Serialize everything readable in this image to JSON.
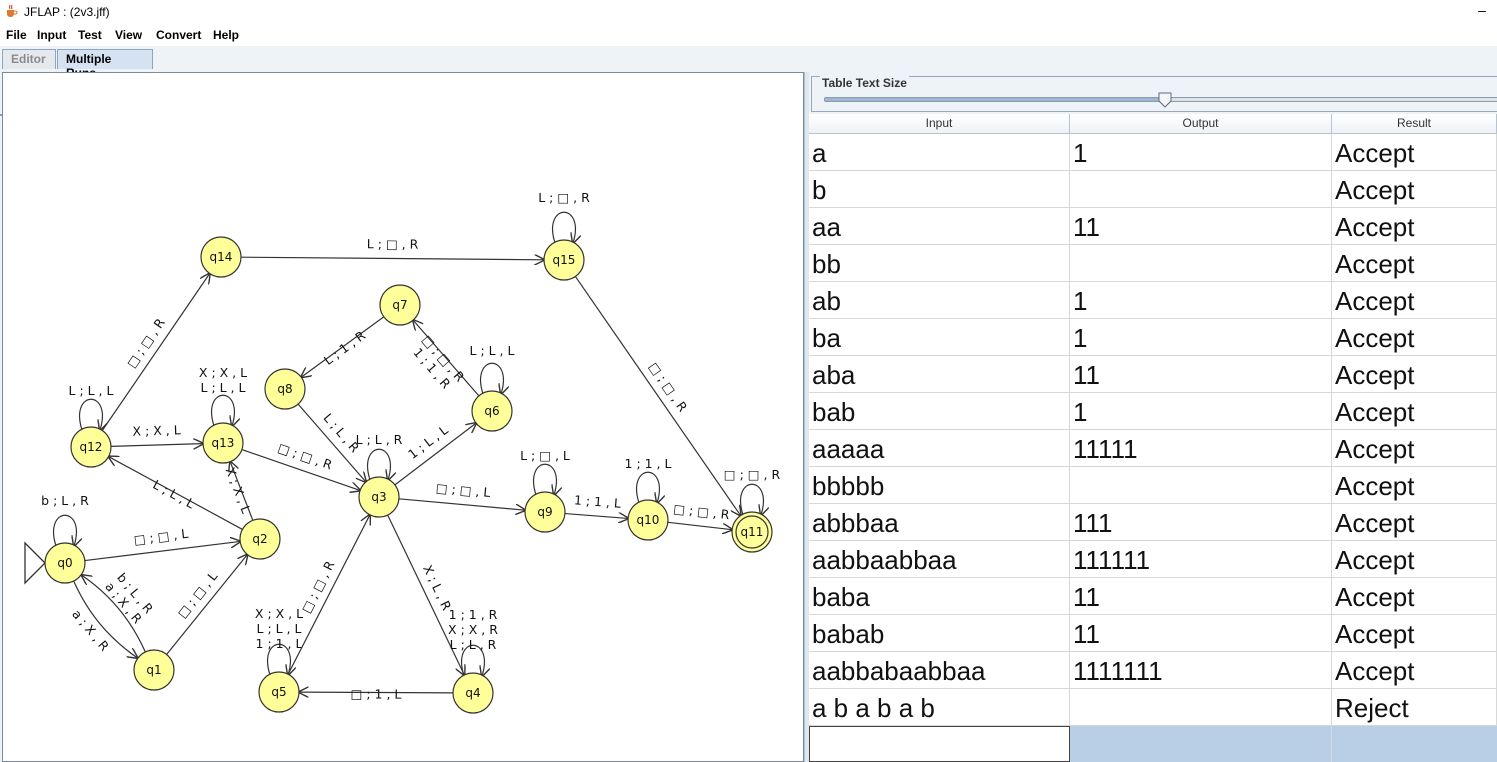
{
  "window": {
    "title": "JFLAP : (2v3.jff)",
    "minimize_glyph": "–",
    "icon": "java-cup-icon"
  },
  "menu": [
    "File",
    "Input",
    "Test",
    "View",
    "Convert",
    "Help"
  ],
  "tabs": [
    {
      "label": "Editor",
      "active": false
    },
    {
      "label": "Multiple Runs",
      "active": true
    }
  ],
  "slider": {
    "label": "Table Text Size",
    "value": 0.5
  },
  "table": {
    "columns": [
      "Input",
      "Output",
      "Result"
    ],
    "rows": [
      {
        "input": "a",
        "output": "1",
        "result": "Accept"
      },
      {
        "input": "b",
        "output": "",
        "result": "Accept"
      },
      {
        "input": "aa",
        "output": "11",
        "result": "Accept"
      },
      {
        "input": "bb",
        "output": "",
        "result": "Accept"
      },
      {
        "input": "ab",
        "output": "1",
        "result": "Accept"
      },
      {
        "input": "ba",
        "output": "1",
        "result": "Accept"
      },
      {
        "input": "aba",
        "output": "11",
        "result": "Accept"
      },
      {
        "input": "bab",
        "output": "1",
        "result": "Accept"
      },
      {
        "input": "aaaaa",
        "output": "11111",
        "result": "Accept"
      },
      {
        "input": "bbbbb",
        "output": "",
        "result": "Accept"
      },
      {
        "input": "abbbaa",
        "output": "111",
        "result": "Accept"
      },
      {
        "input": "aabbaabbaa",
        "output": "111111",
        "result": "Accept"
      },
      {
        "input": "baba",
        "output": "11",
        "result": "Accept"
      },
      {
        "input": "babab",
        "output": "11",
        "result": "Accept"
      },
      {
        "input": "aabbabaabbaa",
        "output": "1111111",
        "result": "Accept"
      },
      {
        "input": "a b a b a b",
        "output": "",
        "result": "Reject"
      }
    ],
    "edit_row": {
      "input": "",
      "output": "",
      "result": ""
    }
  },
  "automaton": {
    "colors": {
      "state_fill": "#ffff99",
      "state_stroke": "#333333",
      "edge": "#333333"
    },
    "initial_state": "q0",
    "final_states": [
      "q11"
    ],
    "states": [
      "q0",
      "q1",
      "q2",
      "q3",
      "q4",
      "q5",
      "q6",
      "q7",
      "q8",
      "q9",
      "q10",
      "q11",
      "q12",
      "q13",
      "q14",
      "q15"
    ],
    "transitions": [
      {
        "from": "q0",
        "to": "q0",
        "labels": [
          "b ; L , R"
        ]
      },
      {
        "from": "q0",
        "to": "q2",
        "labels": [
          "□ ; □ , L"
        ]
      },
      {
        "from": "q0",
        "to": "q1",
        "labels": [
          "a ; X , R"
        ]
      },
      {
        "from": "q1",
        "to": "q0",
        "labels": [
          "b ; L , R",
          "a ; X , R"
        ]
      },
      {
        "from": "q1",
        "to": "q2",
        "labels": [
          "□ ; □ , L"
        ]
      },
      {
        "from": "q2",
        "to": "q13",
        "labels": [
          "X ; X , L"
        ]
      },
      {
        "from": "q2",
        "to": "q12",
        "labels": [
          "L ; L , L"
        ]
      },
      {
        "from": "q12",
        "to": "q12",
        "labels": [
          "L ; L , L"
        ]
      },
      {
        "from": "q12",
        "to": "q13",
        "labels": [
          "X ; X , L"
        ]
      },
      {
        "from": "q12",
        "to": "q14",
        "labels": [
          "□ ; □ , R"
        ]
      },
      {
        "from": "q13",
        "to": "q13",
        "labels": [
          "X ; X , L",
          "L ; L , L"
        ]
      },
      {
        "from": "q13",
        "to": "q3",
        "labels": [
          "□ ; □ , R"
        ]
      },
      {
        "from": "q14",
        "to": "q15",
        "labels": [
          "L ; □ , R"
        ]
      },
      {
        "from": "q15",
        "to": "q15",
        "labels": [
          "L ; □ , R"
        ]
      },
      {
        "from": "q15",
        "to": "q11",
        "labels": [
          "□ ; □ , R"
        ]
      },
      {
        "from": "q7",
        "to": "q8",
        "labels": [
          "L ; 1 , R"
        ]
      },
      {
        "from": "q8",
        "to": "q3",
        "labels": [
          "L ; L , R"
        ]
      },
      {
        "from": "q3",
        "to": "q3",
        "labels": [
          "L ; L , R"
        ]
      },
      {
        "from": "q3",
        "to": "q6",
        "labels": [
          "1 ; L , L"
        ]
      },
      {
        "from": "q6",
        "to": "q6",
        "labels": [
          "L ; L , L"
        ]
      },
      {
        "from": "q6",
        "to": "q7",
        "labels": [
          "□ ; □ , R",
          "1 ; 1 , R"
        ]
      },
      {
        "from": "q3",
        "to": "q9",
        "labels": [
          "□ ; □ , L"
        ]
      },
      {
        "from": "q9",
        "to": "q9",
        "labels": [
          "L ; □ , L"
        ]
      },
      {
        "from": "q9",
        "to": "q10",
        "labels": [
          "1 ; 1 , L"
        ]
      },
      {
        "from": "q10",
        "to": "q10",
        "labels": [
          "1 ; 1 , L"
        ]
      },
      {
        "from": "q10",
        "to": "q11",
        "labels": [
          "□ ; □ , R"
        ]
      },
      {
        "from": "q11",
        "to": "q11",
        "labels": [
          "□ ; □ , R"
        ]
      },
      {
        "from": "q3",
        "to": "q4",
        "labels": [
          "X ; L , R"
        ]
      },
      {
        "from": "q4",
        "to": "q4",
        "labels": [
          "1 ; 1 , R",
          "X ; X , R",
          "L ; L , R"
        ]
      },
      {
        "from": "q4",
        "to": "q5",
        "labels": [
          "□ ; 1 , L"
        ]
      },
      {
        "from": "q5",
        "to": "q5",
        "labels": [
          "X ; X , L",
          "L ; L , L",
          "1 ; 1 , L"
        ]
      },
      {
        "from": "q5",
        "to": "q3",
        "labels": [
          "□ ; □ , R"
        ]
      }
    ]
  }
}
